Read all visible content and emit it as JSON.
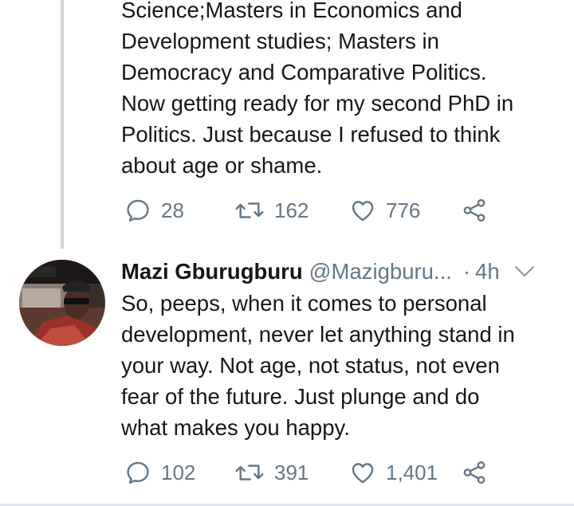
{
  "tweets": [
    {
      "text_lines": [
        "Science;Masters in Economics and",
        "Development studies; Masters in",
        "Democracy and Comparative Politics.",
        "Now getting ready for my second PhD in",
        "Politics. Just because I refused to think",
        "about age or shame."
      ],
      "replies": "28",
      "retweets": "162",
      "likes": "776"
    },
    {
      "display_name": "Mazi Gburugburu",
      "handle": "@Mazigburu...",
      "separator": "·",
      "time": "4h",
      "text_lines": [
        "So, peeps, when it comes to personal",
        "development, never let anything stand in",
        "your way. Not age, not status, not even",
        "fear of the future. Just plunge and do",
        "what makes you happy."
      ],
      "replies": "102",
      "retweets": "391",
      "likes": "1,401"
    }
  ],
  "icons": {
    "reply": "reply-icon",
    "retweet": "retweet-icon",
    "like": "heart-icon",
    "share": "share-icon",
    "caret": "chevron-down-icon"
  },
  "colors": {
    "text": "#14171a",
    "secondary": "#657786",
    "thread_line": "#ccd6dd"
  }
}
